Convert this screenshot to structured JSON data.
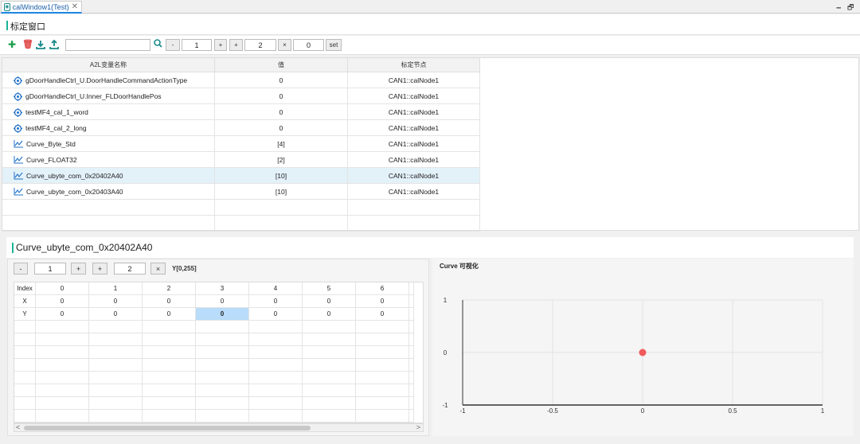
{
  "tab": {
    "title": "calWindow1(Test)"
  },
  "window_controls": {
    "minimize": "🗕",
    "restore": "🗗"
  },
  "page_title": "标定窗口",
  "toolbar": {
    "search_placeholder": "",
    "minus1": "-",
    "val1": "1",
    "plus1": "+",
    "add2": "+",
    "val2": "2",
    "mul2": "×",
    "val3": "0",
    "set": "set"
  },
  "table": {
    "headers": [
      "A2L变量名称",
      "值",
      "标定节点"
    ],
    "rows": [
      {
        "icon": "target-icon",
        "name": "gDoorHandleCtrl_U.DoorHandleCommandActionType",
        "value": "0",
        "node": "CAN1::calNode1"
      },
      {
        "icon": "target-icon",
        "name": "gDoorHandleCtrl_U.Inner_FLDoorHandlePos",
        "value": "0",
        "node": "CAN1::calNode1"
      },
      {
        "icon": "target-icon",
        "name": "testMF4_cal_1_word",
        "value": "0",
        "node": "CAN1::calNode1"
      },
      {
        "icon": "target-icon",
        "name": "testMF4_cal_2_long",
        "value": "0",
        "node": "CAN1::calNode1"
      },
      {
        "icon": "curve-icon",
        "name": "Curve_Byte_Std",
        "value": "[4]",
        "node": "CAN1::calNode1"
      },
      {
        "icon": "curve-icon",
        "name": "Curve_FLOAT32",
        "value": "[2]",
        "node": "CAN1::calNode1"
      },
      {
        "icon": "curve-icon",
        "name": "Curve_ubyte_com_0x20402A40",
        "value": "[10]",
        "node": "CAN1::calNode1"
      },
      {
        "icon": "curve-icon",
        "name": "Curve_ubyte_com_0x20403A40",
        "value": "[10]",
        "node": "CAN1::calNode1"
      }
    ],
    "selected_index": 6
  },
  "detail": {
    "title": "Curve_ubyte_com_0x20402A40",
    "controls": {
      "minus": "-",
      "val1": "1",
      "plus": "+",
      "add": "+",
      "val2": "2",
      "mul": "×",
      "range": "Y[0,255]"
    },
    "grid": {
      "header_label": "Index",
      "indices": [
        "0",
        "1",
        "2",
        "3",
        "4",
        "5",
        "6"
      ],
      "x_label": "X",
      "x_values": [
        "0",
        "0",
        "0",
        "0",
        "0",
        "0",
        "0"
      ],
      "y_label": "Y",
      "y_values": [
        "0",
        "0",
        "0",
        "0",
        "0",
        "0",
        "0"
      ],
      "highlight_col": 3
    },
    "scroll": {
      "left": "<",
      "right": ">"
    }
  },
  "chart_data": {
    "type": "scatter",
    "title": "Curve 可视化",
    "x": [
      0
    ],
    "y": [
      0
    ],
    "xlim": [
      -1,
      1
    ],
    "ylim": [
      -1,
      1
    ],
    "xticks": [
      "-1",
      "-0.5",
      "0",
      "0.5",
      "1"
    ],
    "yticks": [
      "1",
      "0",
      "-1"
    ],
    "grid": true,
    "point_color": "#f05a5a"
  }
}
